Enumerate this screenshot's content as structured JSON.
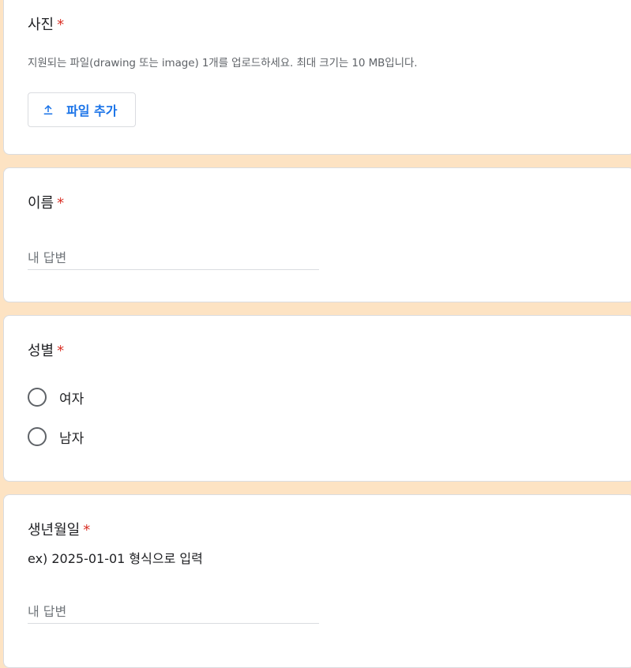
{
  "photo": {
    "title": "사진",
    "required_mark": "*",
    "help_text": "지원되는 파일(drawing 또는 image) 1개를 업로드하세요. 최대 크기는 10 MB입니다.",
    "upload_button_label": "파일 추가"
  },
  "name": {
    "title": "이름",
    "required_mark": "*",
    "placeholder": "내 답변"
  },
  "gender": {
    "title": "성별",
    "required_mark": "*",
    "options": [
      {
        "label": "여자"
      },
      {
        "label": "남자"
      }
    ]
  },
  "birthdate": {
    "title": "생년월일",
    "required_mark": "*",
    "description": "ex) 2025-01-01 형식으로 입력",
    "placeholder": "내 답변"
  },
  "colors": {
    "background": "#fde3c3",
    "required": "#d93025",
    "accent": "#1a73e8"
  }
}
